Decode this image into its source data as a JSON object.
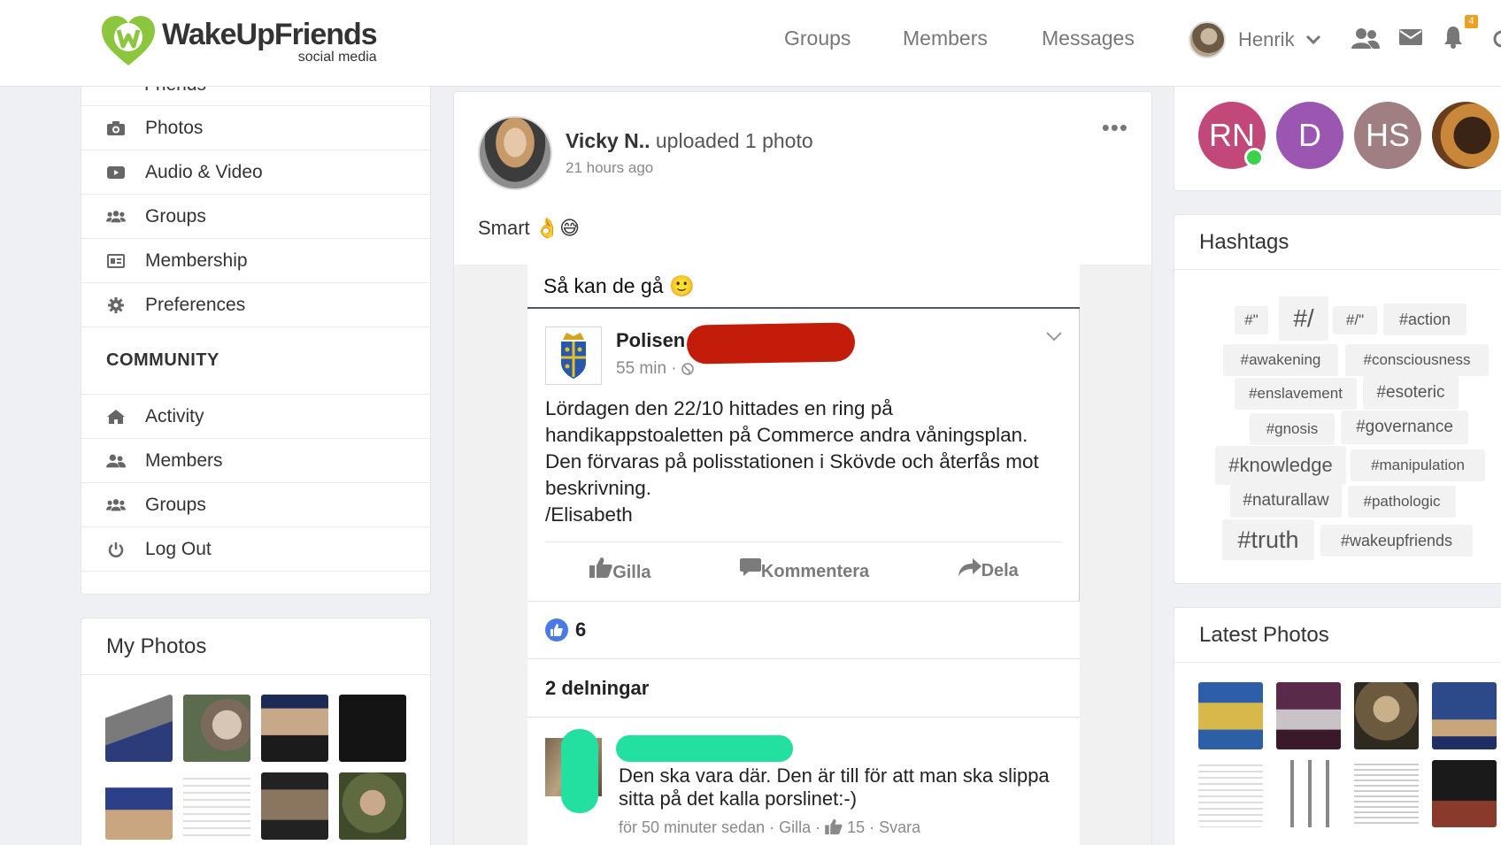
{
  "brand": {
    "name": "WakeUpFriends",
    "tagline": "social media"
  },
  "nav": {
    "groups": "Groups",
    "members": "Members",
    "messages": "Messages"
  },
  "user": {
    "name": "Henrik",
    "notification_count": "4"
  },
  "sidebar": {
    "partial_item": "Friends",
    "items": [
      {
        "label": "Photos",
        "icon": "camera-icon"
      },
      {
        "label": "Audio & Video",
        "icon": "video-icon"
      },
      {
        "label": "Groups",
        "icon": "users-icon"
      },
      {
        "label": "Membership",
        "icon": "id-card-icon"
      },
      {
        "label": "Preferences",
        "icon": "gear-icon"
      }
    ],
    "community_title": "COMMUNITY",
    "community_items": [
      {
        "label": "Activity",
        "icon": "home-icon"
      },
      {
        "label": "Members",
        "icon": "user-friends-icon"
      },
      {
        "label": "Groups",
        "icon": "users-icon"
      },
      {
        "label": "Log Out",
        "icon": "power-icon"
      }
    ]
  },
  "my_photos": {
    "title": "My Photos"
  },
  "post": {
    "author": "Vicky N..",
    "action": "uploaded 1 photo",
    "time": "21 hours ago",
    "text": "Smart 👌😅",
    "image": {
      "caption": "Så kan de gå 🙂",
      "page_name": "Polisen",
      "page_time": "55 min ·",
      "body": "Lördagen den 22/10 hittades en ring på handikappstoaletten på Commerce andra våningsplan. Den förvaras på polisstationen i Skövde och återfås mot beskrivning.\n/Elisabeth",
      "action_like": "Gilla",
      "action_comment": "Kommentera",
      "action_share": "Dela",
      "likes": "6",
      "shares": "2 delningar",
      "comment_text": "Den ska vara där. Den är till för att man ska slippa sitta på det kalla porslinet:-)",
      "comment_meta_a": "för 50 minuter sedan · Gilla ·",
      "comment_meta_b": "15 · Svara"
    }
  },
  "members": [
    {
      "initials": "RN",
      "color": "#c2487a"
    },
    {
      "initials": "D",
      "color": "#9a56b0"
    },
    {
      "initials": "HS",
      "color": "#a07f82"
    }
  ],
  "hashtags": {
    "title": "Hashtags",
    "tags": [
      "#\"",
      "#/",
      "#/\"",
      "#action",
      "#awakening",
      "#consciousness",
      "#enslavement",
      "#esoteric",
      "#gnosis",
      "#governance",
      "#knowledge",
      "#manipulation",
      "#naturallaw",
      "#pathologic",
      "#truth",
      "#wakeupfriends"
    ]
  },
  "latest_photos": {
    "title": "Latest Photos"
  }
}
